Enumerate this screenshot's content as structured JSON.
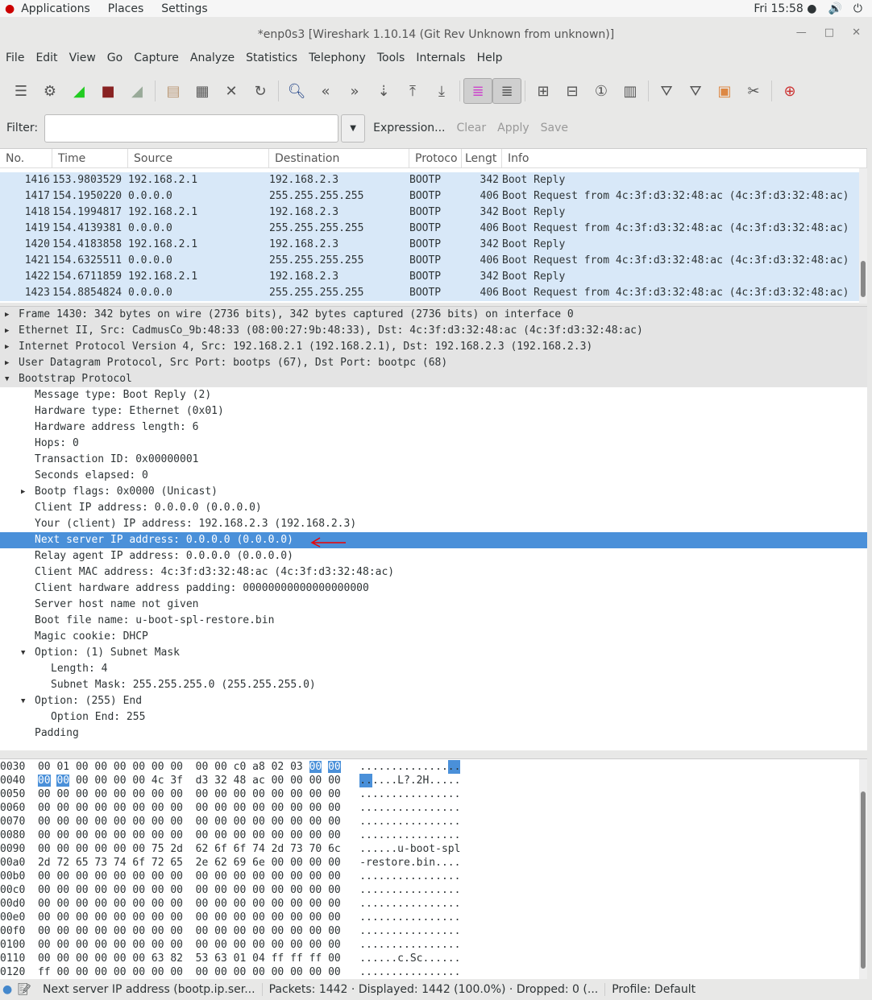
{
  "topbar": {
    "applications": "Applications",
    "places": "Places",
    "settings": "Settings",
    "clock": "Fri 15:58 ●"
  },
  "window": {
    "title": "*enp0s3  [Wireshark 1.10.14  (Git Rev Unknown from unknown)]"
  },
  "menu": [
    "File",
    "Edit",
    "View",
    "Go",
    "Capture",
    "Analyze",
    "Statistics",
    "Telephony",
    "Tools",
    "Internals",
    "Help"
  ],
  "filter": {
    "label": "Filter:",
    "value": "",
    "expression": "Expression...",
    "clear": "Clear",
    "apply": "Apply",
    "save": "Save"
  },
  "packet_list": {
    "columns": [
      "No.",
      "Time",
      "Source",
      "Destination",
      "Protoco",
      "Lengt",
      "Info"
    ],
    "rows": [
      [
        "1416",
        "153.9803529",
        "192.168.2.1",
        "192.168.2.3",
        "BOOTP",
        "342",
        "Boot Reply"
      ],
      [
        "1417",
        "154.1950220",
        "0.0.0.0",
        "255.255.255.255",
        "BOOTP",
        "406",
        "Boot Request from 4c:3f:d3:32:48:ac (4c:3f:d3:32:48:ac)"
      ],
      [
        "1418",
        "154.1994817",
        "192.168.2.1",
        "192.168.2.3",
        "BOOTP",
        "342",
        "Boot Reply"
      ],
      [
        "1419",
        "154.4139381",
        "0.0.0.0",
        "255.255.255.255",
        "BOOTP",
        "406",
        "Boot Request from 4c:3f:d3:32:48:ac (4c:3f:d3:32:48:ac)"
      ],
      [
        "1420",
        "154.4183858",
        "192.168.2.1",
        "192.168.2.3",
        "BOOTP",
        "342",
        "Boot Reply"
      ],
      [
        "1421",
        "154.6325511",
        "0.0.0.0",
        "255.255.255.255",
        "BOOTP",
        "406",
        "Boot Request from 4c:3f:d3:32:48:ac (4c:3f:d3:32:48:ac)"
      ],
      [
        "1422",
        "154.6711859",
        "192.168.2.1",
        "192.168.2.3",
        "BOOTP",
        "342",
        "Boot Reply"
      ],
      [
        "1423",
        "154.8854824",
        "0.0.0.0",
        "255.255.255.255",
        "BOOTP",
        "406",
        "Boot Request from 4c:3f:d3:32:48:ac (4c:3f:d3:32:48:ac)"
      ]
    ]
  },
  "details": [
    {
      "t": "Frame 1430: 342 bytes on wire (2736 bits), 342 bytes captured (2736 bits) on interface 0",
      "l": 0,
      "e": "c"
    },
    {
      "t": "Ethernet II, Src: CadmusCo_9b:48:33 (08:00:27:9b:48:33), Dst: 4c:3f:d3:32:48:ac (4c:3f:d3:32:48:ac)",
      "l": 0,
      "e": "c"
    },
    {
      "t": "Internet Protocol Version 4, Src: 192.168.2.1 (192.168.2.1), Dst: 192.168.2.3 (192.168.2.3)",
      "l": 0,
      "e": "c"
    },
    {
      "t": "User Datagram Protocol, Src Port: bootps (67), Dst Port: bootpc (68)",
      "l": 0,
      "e": "c"
    },
    {
      "t": "Bootstrap Protocol",
      "l": 0,
      "e": "o"
    },
    {
      "t": "Message type: Boot Reply (2)",
      "l": 1
    },
    {
      "t": "Hardware type: Ethernet (0x01)",
      "l": 1
    },
    {
      "t": "Hardware address length: 6",
      "l": 1
    },
    {
      "t": "Hops: 0",
      "l": 1
    },
    {
      "t": "Transaction ID: 0x00000001",
      "l": 1
    },
    {
      "t": "Seconds elapsed: 0",
      "l": 1
    },
    {
      "t": "Bootp flags: 0x0000 (Unicast)",
      "l": 1,
      "e": "c"
    },
    {
      "t": "Client IP address: 0.0.0.0 (0.0.0.0)",
      "l": 1
    },
    {
      "t": "Your (client) IP address: 192.168.2.3 (192.168.2.3)",
      "l": 1
    },
    {
      "t": "Next server IP address: 0.0.0.0 (0.0.0.0)",
      "l": 1,
      "sel": true
    },
    {
      "t": "Relay agent IP address: 0.0.0.0 (0.0.0.0)",
      "l": 1
    },
    {
      "t": "Client MAC address: 4c:3f:d3:32:48:ac (4c:3f:d3:32:48:ac)",
      "l": 1
    },
    {
      "t": "Client hardware address padding: 00000000000000000000",
      "l": 1
    },
    {
      "t": "Server host name not given",
      "l": 1
    },
    {
      "t": "Boot file name: u-boot-spl-restore.bin",
      "l": 1
    },
    {
      "t": "Magic cookie: DHCP",
      "l": 1
    },
    {
      "t": "Option: (1) Subnet Mask",
      "l": 1,
      "e": "o"
    },
    {
      "t": "Length: 4",
      "l": 2
    },
    {
      "t": "Subnet Mask: 255.255.255.0 (255.255.255.0)",
      "l": 2
    },
    {
      "t": "Option: (255) End",
      "l": 1,
      "e": "o"
    },
    {
      "t": "Option End: 255",
      "l": 2
    },
    {
      "t": "Padding",
      "l": 1
    }
  ],
  "hex": [
    {
      "o": "0030",
      "h": "00 01 00 00 00 00 00 00 00 00 c0 a8 02 03 00 00",
      "a": "................",
      "hl": [
        14,
        15
      ]
    },
    {
      "o": "0040",
      "h": "00 00 00 00 00 00 4c 3f d3 32 48 ac 00 00 00 00",
      "a": "......L?.2H.....",
      "hl": [
        0,
        1
      ]
    },
    {
      "o": "0050",
      "h": "00 00 00 00 00 00 00 00 00 00 00 00 00 00 00 00",
      "a": "................"
    },
    {
      "o": "0060",
      "h": "00 00 00 00 00 00 00 00 00 00 00 00 00 00 00 00",
      "a": "................"
    },
    {
      "o": "0070",
      "h": "00 00 00 00 00 00 00 00 00 00 00 00 00 00 00 00",
      "a": "................"
    },
    {
      "o": "0080",
      "h": "00 00 00 00 00 00 00 00 00 00 00 00 00 00 00 00",
      "a": "................"
    },
    {
      "o": "0090",
      "h": "00 00 00 00 00 00 75 2d 62 6f 6f 74 2d 73 70 6c",
      "a": "......u-boot-spl"
    },
    {
      "o": "00a0",
      "h": "2d 72 65 73 74 6f 72 65 2e 62 69 6e 00 00 00 00",
      "a": "-restore.bin...."
    },
    {
      "o": "00b0",
      "h": "00 00 00 00 00 00 00 00 00 00 00 00 00 00 00 00",
      "a": "................"
    },
    {
      "o": "00c0",
      "h": "00 00 00 00 00 00 00 00 00 00 00 00 00 00 00 00",
      "a": "................"
    },
    {
      "o": "00d0",
      "h": "00 00 00 00 00 00 00 00 00 00 00 00 00 00 00 00",
      "a": "................"
    },
    {
      "o": "00e0",
      "h": "00 00 00 00 00 00 00 00 00 00 00 00 00 00 00 00",
      "a": "................"
    },
    {
      "o": "00f0",
      "h": "00 00 00 00 00 00 00 00 00 00 00 00 00 00 00 00",
      "a": "................"
    },
    {
      "o": "0100",
      "h": "00 00 00 00 00 00 00 00 00 00 00 00 00 00 00 00",
      "a": "................"
    },
    {
      "o": "0110",
      "h": "00 00 00 00 00 00 63 82 53 63 01 04 ff ff ff 00",
      "a": "......c.Sc......"
    },
    {
      "o": "0120",
      "h": "ff 00 00 00 00 00 00 00 00 00 00 00 00 00 00 00",
      "a": "................"
    }
  ],
  "status": {
    "field": "Next server IP address (bootp.ip.ser...",
    "packets": "Packets: 1442 · Displayed: 1442 (100.0%) · Dropped: 0 (...",
    "profile": "Profile: Default"
  }
}
